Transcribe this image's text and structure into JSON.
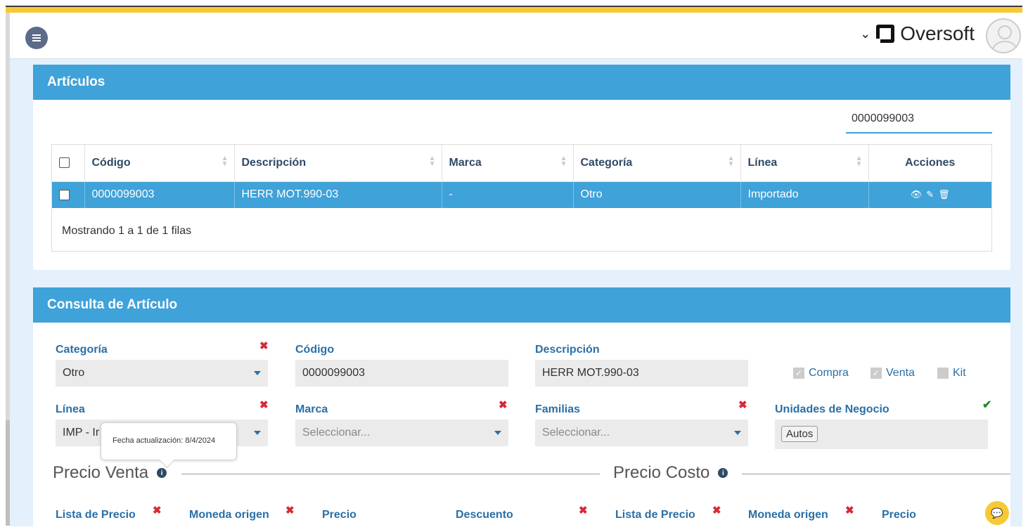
{
  "header": {
    "brand": "Oversoft",
    "brand_chevron": "⌄"
  },
  "articulos": {
    "title": "Artículos",
    "search_value": "0000099003",
    "columns": [
      "Código",
      "Descripción",
      "Marca",
      "Categoría",
      "Línea",
      "Acciones"
    ],
    "rows": [
      {
        "codigo": "0000099003",
        "descripcion": "HERR MOT.990-03",
        "marca": "-",
        "categoria": "Otro",
        "linea": "Importado"
      }
    ],
    "footer": "Mostrando 1 a 1 de 1 filas"
  },
  "consulta": {
    "title": "Consulta de Artículo",
    "categoria_label": "Categoría",
    "categoria_value": "Otro",
    "codigo_label": "Código",
    "codigo_value": "0000099003",
    "descripcion_label": "Descripción",
    "descripcion_value": "HERR MOT.990-03",
    "compra_label": "Compra",
    "venta_label": "Venta",
    "kit_label": "Kit",
    "linea_label": "Línea",
    "linea_value": "IMP - Ir",
    "marca_label": "Marca",
    "marca_placeholder": "Seleccionar...",
    "familias_label": "Familias",
    "familias_placeholder": "Seleccionar...",
    "unidades_label": "Unidades de Negocio",
    "unidades_tag": "Autos",
    "tooltip": "Fecha actualización: 8/4/2024",
    "precio_venta": "Precio Venta",
    "precio_costo": "Precio Costo",
    "cols": {
      "lista_precio_1": "Lista de Precio",
      "moneda_origen_1": "Moneda origen",
      "precio_1": "Precio",
      "descuento": "Descuento",
      "lista_precio_2": "Lista de Precio",
      "moneda_origen_2": "Moneda origen",
      "precio_2": "Precio"
    }
  },
  "colors": {
    "accent": "#3fa2d8",
    "stripe": "#f7c934",
    "label": "#2a6fa7",
    "remove": "#d9263b"
  }
}
